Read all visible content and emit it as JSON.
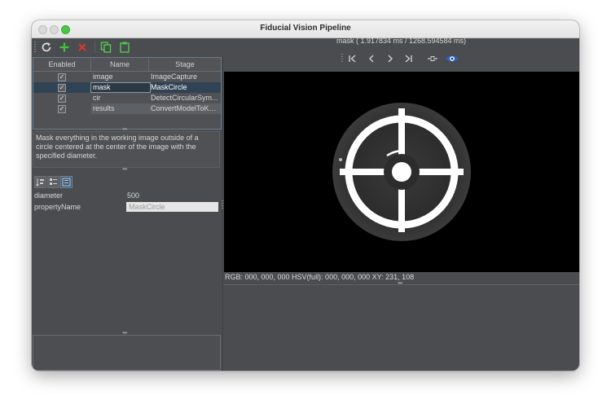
{
  "window": {
    "title": "Fiducial Vision Pipeline"
  },
  "toolbar": {
    "icons": [
      "refresh-icon",
      "add-icon",
      "delete-icon",
      "copy-icon",
      "paste-icon"
    ],
    "colors": {
      "add": "#3fc43f",
      "delete": "#e03434",
      "copy": "#4fc94f"
    }
  },
  "stages_table": {
    "headers": {
      "enabled": "Enabled",
      "name": "Name",
      "stage": "Stage"
    },
    "rows": [
      {
        "enabled": true,
        "name": "image",
        "stage": "ImageCapture"
      },
      {
        "enabled": true,
        "name": "mask",
        "stage": "MaskCircle"
      },
      {
        "enabled": true,
        "name": "cir",
        "stage": "DetectCircularSym..."
      },
      {
        "enabled": true,
        "name": "results",
        "stage": "ConvertModelToKe..."
      }
    ],
    "selected_row": 1
  },
  "description": {
    "text": "Mask everything in the working image outside of a circle centered at the center of the image with the specified diameter."
  },
  "properties": {
    "diameter": {
      "label": "diameter",
      "value": "500"
    },
    "propertyName": {
      "label": "propertyName",
      "value": "MaskCircle"
    }
  },
  "viewer": {
    "title": "mask ( 1.917834 ms / 1268.594584 ms)",
    "status": "RGB: 000, 000, 000 HSV(full): 000, 000, 000 XY: 231, 108",
    "nav_icons": [
      "first-icon",
      "prev-icon",
      "next-icon",
      "last-icon",
      "dash-icon",
      "eye-icon"
    ]
  },
  "handle_glyph": "•••"
}
